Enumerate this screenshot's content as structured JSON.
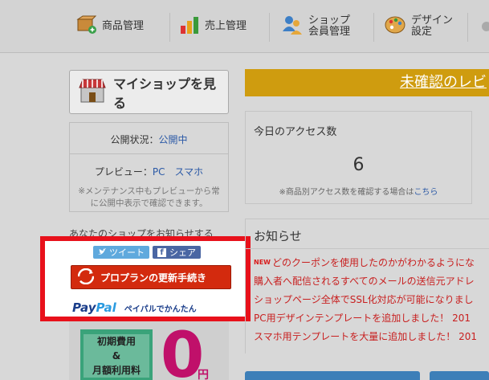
{
  "nav": {
    "items": [
      {
        "label": "商品管理",
        "icon": "package-icon"
      },
      {
        "label": "売上管理",
        "icon": "bar-chart-icon"
      },
      {
        "label_line1": "ショップ",
        "label_line2": "会員管理",
        "icon": "members-icon"
      },
      {
        "label_line1": "デザイン",
        "label_line2": "設定",
        "icon": "palette-icon"
      }
    ]
  },
  "sidebar": {
    "myshop_label": "マイショップを見る",
    "status_label": "公開状況：",
    "status_value": "公開中",
    "preview_label": "プレビュー：",
    "preview_pc": "PC",
    "preview_sp": "スマホ",
    "maintenance_note": "※メンテナンス中もプレビューから常に公開中表示で確認できます。",
    "inform_text": "あなたのショップをお知らせする",
    "tweet_label": "ツイート",
    "share_label": "シェア",
    "renew_label": "プロプランの更新手続き",
    "paypal_logo_1": "Pay",
    "paypal_logo_2": "Pal",
    "paypal_text": "ペイパルでかんたん",
    "fee_line1": "初期費用",
    "fee_line2": "&",
    "fee_line3": "月額利用料",
    "fee_value": "0",
    "fee_unit": "円"
  },
  "main": {
    "unconfirmed_label": "未確認のレビ",
    "access_title": "今日のアクセス数",
    "access_count": "6",
    "access_note_prefix": "※商品別アクセス数を確認する場合は",
    "access_note_link": "こちら",
    "news_title": "お知らせ",
    "news_new_badge": "NEW",
    "news_items": [
      "どのクーポンを使用したのかがわかるようにな",
      "購入者へ配信されるすべてのメールの送信元アドレ",
      "ショップページ全体でSSL化対応が可能になりまし",
      "PC用デザインテンプレートを追加しました！ 201",
      "スマホ用テンプレートを大量に追加しました！ 201"
    ]
  },
  "colors": {
    "highlight": "#e8111b",
    "unconfirmed_bg": "#cf9c0f",
    "renew_bg": "#d32a0e",
    "link": "#2b59a6",
    "news_text": "#c82020"
  }
}
